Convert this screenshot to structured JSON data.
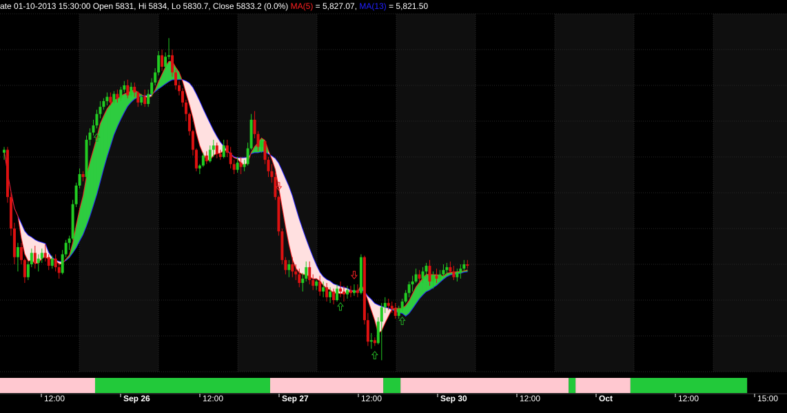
{
  "header": {
    "info_text": "ate 01-10-2013 15:30:00 Open 5831, Hi 5834, Lo 5830.7, Close 5833.2 (0.0%)",
    "ma5_label": "MA(5)",
    "ma5_value": " = 5,827.07,",
    "ma13_label": "MA(13)",
    "ma13_value": " = 5,821.50"
  },
  "colors": {
    "background": "#000000",
    "panel_stripe": "#0f0f0f",
    "grid": "#2a2a2a",
    "bull": "#22cc22",
    "bear": "#dd1111",
    "band_up": "#2ecc40",
    "band_down": "#ffe0e0",
    "ma5_line": "#ff2020",
    "ma13_line": "#2020ff",
    "trend_up": "#22c93a",
    "trend_down": "#ffc8d0",
    "arrow_up": "#22aa22",
    "arrow_down": "#ee2222",
    "axis_text": "#ffffff"
  },
  "chart_data": {
    "type": "candlestick",
    "interval_note": "intraday",
    "x_tick_labels": [
      {
        "label": "12:00",
        "day_label": false
      },
      {
        "label": "Sep 26",
        "day_label": true
      },
      {
        "label": "12:00",
        "day_label": false
      },
      {
        "label": "Sep 27",
        "day_label": true
      },
      {
        "label": "12:00",
        "day_label": false
      },
      {
        "label": "Sep 30",
        "day_label": true
      },
      {
        "label": "12:00",
        "day_label": false
      },
      {
        "label": "Oct",
        "day_label": true
      },
      {
        "label": "12:00",
        "day_label": false
      },
      {
        "label": "15:00",
        "day_label": false
      }
    ],
    "ylim": [
      5700,
      5950
    ],
    "ma_periods": [
      5,
      13
    ],
    "candles": [
      [
        5853,
        5857,
        5848,
        5855
      ],
      [
        5855,
        5857,
        5818,
        5822
      ],
      [
        5822,
        5826,
        5795,
        5800
      ],
      [
        5800,
        5804,
        5775,
        5780
      ],
      [
        5780,
        5790,
        5770,
        5787
      ],
      [
        5787,
        5790,
        5775,
        5778
      ],
      [
        5778,
        5779,
        5762,
        5766
      ],
      [
        5766,
        5777,
        5764,
        5775
      ],
      [
        5775,
        5786,
        5773,
        5783
      ],
      [
        5783,
        5788,
        5772,
        5776
      ],
      [
        5776,
        5782,
        5770,
        5779
      ],
      [
        5779,
        5786,
        5776,
        5783
      ],
      [
        5783,
        5789,
        5777,
        5780
      ],
      [
        5780,
        5782,
        5771,
        5774
      ],
      [
        5774,
        5781,
        5772,
        5779
      ],
      [
        5779,
        5782,
        5770,
        5773
      ],
      [
        5773,
        5776,
        5765,
        5769
      ],
      [
        5769,
        5785,
        5768,
        5782
      ],
      [
        5782,
        5792,
        5780,
        5790
      ],
      [
        5790,
        5795,
        5785,
        5793
      ],
      [
        5793,
        5820,
        5792,
        5817
      ],
      [
        5817,
        5832,
        5815,
        5830
      ],
      [
        5830,
        5842,
        5828,
        5838
      ],
      [
        5838,
        5840,
        5833,
        5836
      ],
      [
        5836,
        5865,
        5835,
        5862
      ],
      [
        5862,
        5870,
        5858,
        5867
      ],
      [
        5867,
        5876,
        5865,
        5872
      ],
      [
        5872,
        5883,
        5870,
        5880
      ],
      [
        5880,
        5889,
        5877,
        5885
      ],
      [
        5885,
        5891,
        5883,
        5889
      ],
      [
        5889,
        5895,
        5886,
        5892
      ],
      [
        5892,
        5895,
        5886,
        5888
      ],
      [
        5888,
        5896,
        5887,
        5894
      ],
      [
        5894,
        5897,
        5888,
        5891
      ],
      [
        5891,
        5899,
        5889,
        5897
      ],
      [
        5897,
        5903,
        5895,
        5900
      ],
      [
        5900,
        5904,
        5891,
        5893
      ],
      [
        5893,
        5902,
        5892,
        5899
      ],
      [
        5899,
        5902,
        5892,
        5895
      ],
      [
        5895,
        5896,
        5885,
        5888
      ],
      [
        5888,
        5894,
        5886,
        5892
      ],
      [
        5892,
        5897,
        5885,
        5887
      ],
      [
        5887,
        5897,
        5885,
        5894
      ],
      [
        5894,
        5905,
        5892,
        5902
      ],
      [
        5902,
        5912,
        5900,
        5909
      ],
      [
        5909,
        5924,
        5907,
        5921
      ],
      [
        5921,
        5925,
        5910,
        5913
      ],
      [
        5913,
        5923,
        5912,
        5920
      ],
      [
        5920,
        5933,
        5918,
        5921
      ],
      [
        5921,
        5925,
        5906,
        5909
      ],
      [
        5909,
        5911,
        5897,
        5900
      ],
      [
        5900,
        5903,
        5893,
        5896
      ],
      [
        5896,
        5898,
        5885,
        5888
      ],
      [
        5888,
        5890,
        5875,
        5880
      ],
      [
        5880,
        5881,
        5865,
        5868
      ],
      [
        5868,
        5869,
        5851,
        5855
      ],
      [
        5855,
        5856,
        5840,
        5842
      ],
      [
        5842,
        5845,
        5838,
        5844
      ],
      [
        5844,
        5853,
        5843,
        5851
      ],
      [
        5851,
        5854,
        5845,
        5847
      ],
      [
        5847,
        5858,
        5846,
        5855
      ],
      [
        5855,
        5862,
        5850,
        5858
      ],
      [
        5858,
        5860,
        5849,
        5852
      ],
      [
        5852,
        5855,
        5848,
        5850
      ],
      [
        5850,
        5862,
        5849,
        5858
      ],
      [
        5858,
        5862,
        5850,
        5853
      ],
      [
        5853,
        5857,
        5842,
        5845
      ],
      [
        5845,
        5848,
        5838,
        5841
      ],
      [
        5841,
        5850,
        5839,
        5846
      ],
      [
        5846,
        5850,
        5838,
        5843
      ],
      [
        5843,
        5848,
        5840,
        5845
      ],
      [
        5845,
        5860,
        5844,
        5856
      ],
      [
        5856,
        5880,
        5855,
        5876
      ],
      [
        5876,
        5882,
        5863,
        5866
      ],
      [
        5866,
        5868,
        5854,
        5857
      ],
      [
        5857,
        5863,
        5853,
        5861
      ],
      [
        5861,
        5862,
        5845,
        5848
      ],
      [
        5848,
        5850,
        5836,
        5840
      ],
      [
        5840,
        5845,
        5832,
        5836
      ],
      [
        5836,
        5839,
        5820,
        5822
      ],
      [
        5822,
        5823,
        5795,
        5798
      ],
      [
        5798,
        5800,
        5775,
        5778
      ],
      [
        5778,
        5780,
        5768,
        5771
      ],
      [
        5771,
        5778,
        5766,
        5775
      ],
      [
        5775,
        5780,
        5766,
        5770
      ],
      [
        5770,
        5775,
        5764,
        5768
      ],
      [
        5768,
        5772,
        5759,
        5762
      ],
      [
        5762,
        5769,
        5756,
        5765
      ],
      [
        5765,
        5777,
        5763,
        5773
      ],
      [
        5773,
        5777,
        5761,
        5764
      ],
      [
        5764,
        5768,
        5757,
        5760
      ],
      [
        5760,
        5764,
        5757,
        5763
      ],
      [
        5763,
        5767,
        5753,
        5756
      ],
      [
        5756,
        5763,
        5752,
        5759
      ],
      [
        5759,
        5762,
        5749,
        5752
      ],
      [
        5752,
        5759,
        5748,
        5756
      ],
      [
        5756,
        5758,
        5747,
        5750
      ],
      [
        5750,
        5761,
        5749,
        5758
      ],
      [
        5758,
        5763,
        5752,
        5756
      ],
      [
        5756,
        5760,
        5749,
        5754
      ],
      [
        5754,
        5760,
        5751,
        5757
      ],
      [
        5757,
        5760,
        5752,
        5755
      ],
      [
        5755,
        5761,
        5753,
        5757
      ],
      [
        5757,
        5761,
        5752,
        5755
      ],
      [
        5755,
        5782,
        5754,
        5780
      ],
      [
        5780,
        5781,
        5733,
        5736
      ],
      [
        5736,
        5741,
        5718,
        5721
      ],
      [
        5721,
        5727,
        5716,
        5722
      ],
      [
        5722,
        5724,
        5718,
        5720
      ],
      [
        5720,
        5738,
        5719,
        5735
      ],
      [
        5735,
        5748,
        5708,
        5745
      ],
      [
        5745,
        5752,
        5741,
        5748
      ],
      [
        5748,
        5751,
        5743,
        5746
      ],
      [
        5746,
        5749,
        5741,
        5744
      ],
      [
        5744,
        5748,
        5737,
        5739
      ],
      [
        5739,
        5746,
        5737,
        5744
      ],
      [
        5744,
        5751,
        5742,
        5749
      ],
      [
        5749,
        5757,
        5748,
        5755
      ],
      [
        5755,
        5763,
        5752,
        5761
      ],
      [
        5761,
        5767,
        5756,
        5763
      ],
      [
        5763,
        5772,
        5762,
        5768
      ],
      [
        5768,
        5771,
        5762,
        5765
      ],
      [
        5765,
        5773,
        5762,
        5770
      ],
      [
        5770,
        5776,
        5765,
        5774
      ],
      [
        5774,
        5778,
        5760,
        5763
      ],
      [
        5763,
        5770,
        5758,
        5767
      ],
      [
        5767,
        5772,
        5762,
        5765
      ],
      [
        5765,
        5771,
        5763,
        5768
      ],
      [
        5768,
        5775,
        5766,
        5771
      ],
      [
        5771,
        5776,
        5768,
        5773
      ],
      [
        5773,
        5777,
        5769,
        5770
      ],
      [
        5770,
        5774,
        5764,
        5766
      ],
      [
        5766,
        5772,
        5763,
        5769
      ],
      [
        5769,
        5775,
        5765,
        5772
      ],
      [
        5772,
        5778,
        5770,
        5775
      ],
      [
        5775,
        5778,
        5772,
        5774
      ]
    ],
    "signals": [
      {
        "type": "up",
        "index": 27
      },
      {
        "type": "down",
        "index": 80
      },
      {
        "type": "up",
        "index": 98
      },
      {
        "type": "down",
        "index": 102
      },
      {
        "type": "up",
        "index": 108
      },
      {
        "type": "up",
        "index": 116
      }
    ],
    "trend_bar": [
      {
        "from": 0,
        "to": 27,
        "state": "down"
      },
      {
        "from": 27,
        "to": 78,
        "state": "up"
      },
      {
        "from": 78,
        "to": 111,
        "state": "down"
      },
      {
        "from": 111,
        "to": 116,
        "state": "up"
      },
      {
        "from": 116,
        "to": 165,
        "state": "down"
      },
      {
        "from": 165,
        "to": 167,
        "state": "up"
      },
      {
        "from": 167,
        "to": 183,
        "state": "down"
      },
      {
        "from": 183,
        "to": 217,
        "state": "up"
      }
    ]
  }
}
